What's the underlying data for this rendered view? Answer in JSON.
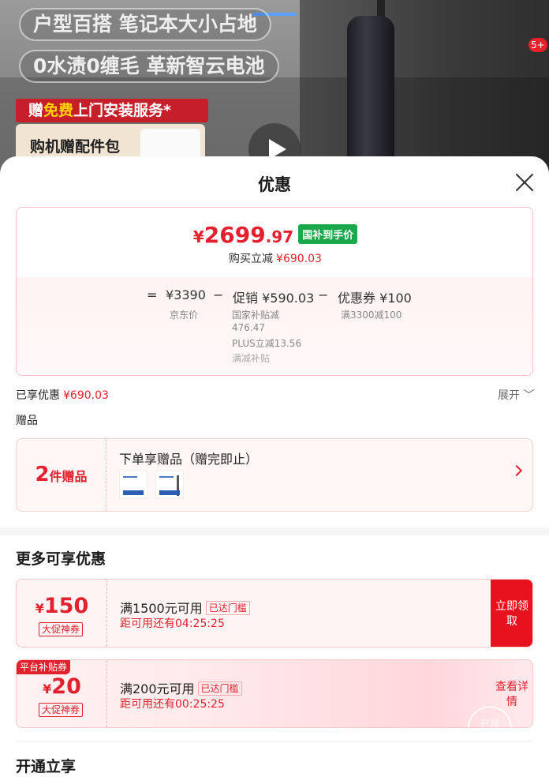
{
  "background": {
    "pill1": "户型百搭 笔记本大小占地",
    "pill2": "0水渍0缠毛 革新智云电池",
    "service_prefix": "赠",
    "service_free": "免费",
    "service_suffix": "上门安装服务*",
    "gift_card": "购机赠配件包",
    "notif_badge": "5+"
  },
  "sheet": {
    "title": "优惠",
    "price": {
      "yen": "¥",
      "integer": "2699",
      "decimal": ".97",
      "tag": "国补到手价",
      "buy_reduce_label": "购买立减",
      "buy_reduce_amount": "¥690.03"
    },
    "formula": {
      "eq": "=",
      "jd_price": "¥3390",
      "minus1": "−",
      "promo": "促销 ¥590.03",
      "minus2": "−",
      "coupon": "优惠券 ¥100",
      "jd_label": "京东价",
      "gov_sub": "国家补贴减476.47",
      "plus_sub": "PLUS立减13.56",
      "other_sub": "满减补贴",
      "coupon_sub": "满3300减100"
    },
    "enjoyed_label": "已享优惠",
    "enjoyed_amount": "¥690.03",
    "expand": "展开 ﹀",
    "gifts_label": "赠品",
    "gift": {
      "count": "2",
      "unit": "件赠品",
      "title": "下单享赠品（赠完即止）"
    },
    "more_title": "更多可享优惠",
    "coupons": [
      {
        "yen": "¥",
        "amount": "150",
        "type": "大促神券",
        "condition": "满1500元可用",
        "tag": "已达门槛",
        "countdown": "距可用还有04:25:25",
        "button": "立即领取"
      },
      {
        "badge": "平台补贴券",
        "yen": "¥",
        "amount": "20",
        "type": "大促神券",
        "condition": "满200元可用",
        "tag": "已达门槛",
        "countdown": "距可用还有00:25:25",
        "button": "查看详情",
        "stamp": "已领"
      }
    ],
    "open_title": "开通立享"
  },
  "colors": {
    "accent_red": "#e3202e",
    "gov_green": "#1aa84a",
    "progress_blue": "#5aa0ff"
  }
}
